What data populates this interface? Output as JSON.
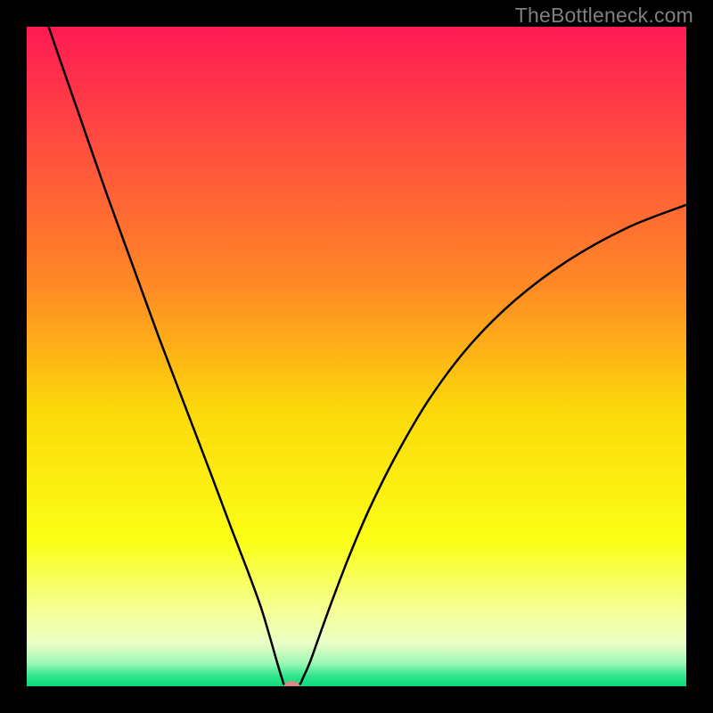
{
  "watermark": "TheBottleneck.com",
  "chart_data": {
    "type": "line",
    "title": "",
    "xlabel": "",
    "ylabel": "",
    "xlim": [
      0,
      100
    ],
    "ylim": [
      0,
      100
    ],
    "background_gradient": {
      "stops": [
        {
          "offset": 0.0,
          "color": "#ff1a54"
        },
        {
          "offset": 0.4,
          "color": "#ff8c24"
        },
        {
          "offset": 0.58,
          "color": "#fcd80a"
        },
        {
          "offset": 0.78,
          "color": "#fbff16"
        },
        {
          "offset": 0.88,
          "color": "#f6ff8f"
        },
        {
          "offset": 0.935,
          "color": "#ecffc6"
        },
        {
          "offset": 0.965,
          "color": "#9cf7b6"
        },
        {
          "offset": 0.985,
          "color": "#2de58d"
        },
        {
          "offset": 1.0,
          "color": "#0ed979"
        }
      ]
    },
    "series": [
      {
        "name": "bottleneck-curve",
        "color": "#000000",
        "x": [
          0.0,
          4.0,
          8.0,
          12.0,
          16.0,
          20.0,
          24.0,
          28.0,
          31.0,
          33.5,
          35.5,
          37.0,
          38.0,
          38.7,
          39.2,
          41.2,
          41.9,
          43.0,
          44.5,
          46.5,
          49.0,
          52.0,
          56.0,
          61.0,
          67.0,
          74.0,
          82.0,
          91.0,
          100.0
        ],
        "y": [
          110.0,
          98.0,
          86.5,
          75.0,
          64.0,
          53.0,
          42.5,
          32.0,
          24.0,
          17.5,
          12.0,
          7.0,
          3.5,
          1.2,
          0.2,
          0.2,
          1.3,
          3.8,
          8.0,
          13.5,
          20.0,
          27.0,
          35.0,
          43.5,
          51.5,
          58.5,
          64.5,
          69.5,
          73.0
        ]
      }
    ],
    "marker": {
      "name": "optimal-point",
      "x": 40.2,
      "y": 0.0,
      "color": "#d98a88",
      "rx": 1.2,
      "ry": 0.8
    }
  }
}
